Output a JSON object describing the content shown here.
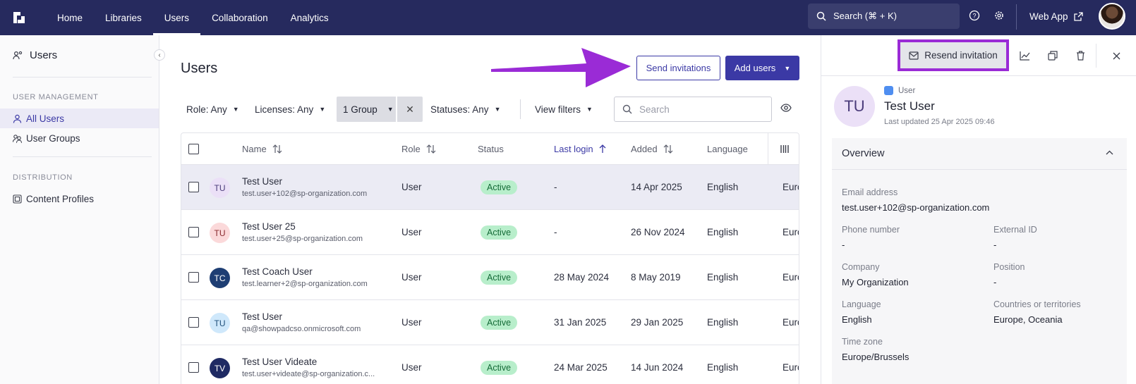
{
  "nav": {
    "items": [
      "Home",
      "Libraries",
      "Users",
      "Collaboration",
      "Analytics"
    ],
    "active": "Users",
    "search_label": "Search (⌘ + K)",
    "web_app_label": "Web App"
  },
  "sidebar": {
    "title": "Users",
    "sections": [
      {
        "heading": "USER MANAGEMENT",
        "items": [
          "All Users",
          "User Groups"
        ]
      },
      {
        "heading": "DISTRIBUTION",
        "items": [
          "Content Profiles"
        ]
      }
    ]
  },
  "main": {
    "title": "Users",
    "send_invitations_label": "Send invitations",
    "add_users_label": "Add users",
    "filters": {
      "role": "Role: Any",
      "licenses": "Licenses: Any",
      "group": "1 Group",
      "statuses": "Statuses: Any",
      "view_filters": "View filters"
    },
    "search_placeholder": "Search",
    "table": {
      "columns": [
        "Name",
        "Role",
        "Status",
        "Last login",
        "Added",
        "Language"
      ],
      "sorted_column": "Last login",
      "rows": [
        {
          "initials": "TU",
          "name": "Test User",
          "email": "test.user+102@sp-organization.com",
          "role": "User",
          "status": "Active",
          "last_login": "-",
          "added": "14 Apr 2025",
          "language": "English",
          "region": "Euro",
          "avatar_bg": "#ebe0f7",
          "avatar_fg": "#4a3b7a"
        },
        {
          "initials": "TU",
          "name": "Test User 25",
          "email": "test.user+25@sp-organization.com",
          "role": "User",
          "status": "Active",
          "last_login": "-",
          "added": "26 Nov 2024",
          "language": "English",
          "region": "Euro",
          "avatar_bg": "#fbd9da",
          "avatar_fg": "#8a2a2e"
        },
        {
          "initials": "TC",
          "name": "Test Coach User",
          "email": "test.learner+2@sp-organization.com",
          "role": "User",
          "status": "Active",
          "last_login": "28 May 2024",
          "added": "8 May 2019",
          "language": "English",
          "region": "Euro",
          "avatar_bg": "#1e3e73",
          "avatar_fg": "#ffffff"
        },
        {
          "initials": "TU",
          "name": "Test User",
          "email": "qa@showpadcso.onmicrosoft.com",
          "role": "User",
          "status": "Active",
          "last_login": "31 Jan 2025",
          "added": "29 Jan 2025",
          "language": "English",
          "region": "Euro",
          "avatar_bg": "#cfe8fb",
          "avatar_fg": "#1e4e7a"
        },
        {
          "initials": "TV",
          "name": "Test User Videate",
          "email": "test.user+videate@sp-organization.c...",
          "role": "User",
          "status": "Active",
          "last_login": "24 Mar 2025",
          "added": "14 Jun 2024",
          "language": "English",
          "region": "Euro",
          "avatar_bg": "#1f2a63",
          "avatar_fg": "#ffffff"
        }
      ]
    }
  },
  "panel": {
    "resend_label": "Resend invitation",
    "initials": "TU",
    "user_type": "User",
    "name": "Test User",
    "updated": "Last updated 25 Apr 2025 09:46",
    "overview_title": "Overview",
    "fields": {
      "email_label": "Email address",
      "email_value": "test.user+102@sp-organization.com",
      "phone_label": "Phone number",
      "phone_value": "-",
      "external_label": "External ID",
      "external_value": "-",
      "company_label": "Company",
      "company_value": "My Organization",
      "position_label": "Position",
      "position_value": "-",
      "language_label": "Language",
      "language_value": "English",
      "countries_label": "Countries or territories",
      "countries_value": "Europe, Oceania",
      "timezone_label": "Time zone",
      "timezone_value": "Europe/Brussels"
    }
  },
  "colors": {
    "topbar": "#262a5e",
    "accent": "#3b39a5",
    "highlight": "#9a2bd6",
    "active_badge": "#b8eecb"
  }
}
